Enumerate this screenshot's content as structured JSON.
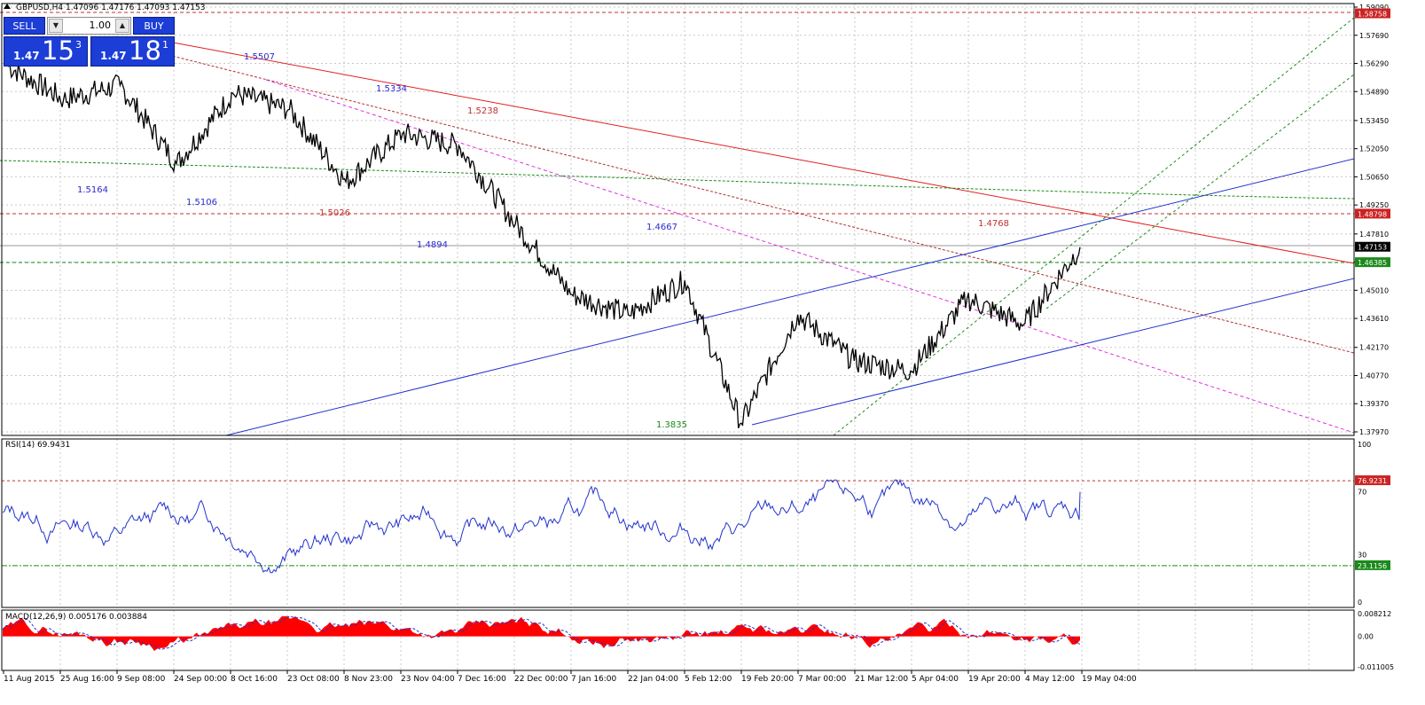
{
  "header": {
    "title": "GBPUSD,H4 1.47096 1.47176 1.47093 1.47153"
  },
  "trade_panel": {
    "sell_label": "SELL",
    "buy_label": "BUY",
    "lot": "1.00",
    "sell_prefix": "1.47",
    "sell_big": "15",
    "sell_sup": "3",
    "buy_prefix": "1.47",
    "buy_big": "18",
    "buy_sup": "1",
    "arrow_down": "▼",
    "arrow_up": "▲"
  },
  "price_axis": {
    "ticks": [
      "1.59090",
      "1.57690",
      "1.56290",
      "1.54890",
      "1.53450",
      "1.52050",
      "1.50650",
      "1.49250",
      "1.47810",
      "1.46410",
      "1.45010",
      "1.43610",
      "1.42170",
      "1.40770",
      "1.39370",
      "1.37970"
    ],
    "highlights": [
      {
        "label": "1.58758",
        "color": "#cc2222",
        "text_color": "#ffffff"
      },
      {
        "label": "1.48798",
        "color": "#cc2222",
        "text_color": "#ffffff"
      },
      {
        "label": "1.47153",
        "color": "#000000",
        "text_color": "#ffffff"
      },
      {
        "label": "1.46385",
        "color": "#1a8a1a",
        "text_color": "#ffffff"
      }
    ]
  },
  "annotations": [
    {
      "text": "1.5507",
      "color": "#2a2ad0"
    },
    {
      "text": "1.5334",
      "color": "#2a2ad0"
    },
    {
      "text": "1.5238",
      "color": "#c03030"
    },
    {
      "text": "1.5164",
      "color": "#2a2ad0"
    },
    {
      "text": "1.5106",
      "color": "#2a2ad0"
    },
    {
      "text": "1.5026",
      "color": "#c03030"
    },
    {
      "text": "1.4894",
      "color": "#2a2ad0"
    },
    {
      "text": "1.4667",
      "color": "#2a2ad0"
    },
    {
      "text": "1.4768",
      "color": "#c03030"
    },
    {
      "text": "1.3835",
      "color": "#1a8a1a"
    }
  ],
  "rsi": {
    "label": "RSI(14) 69.9431",
    "ticks": [
      "100",
      "70",
      "30",
      "0"
    ],
    "high_level": "76.9231",
    "low_level": "23.1156"
  },
  "macd": {
    "label": "MACD(12,26,9) 0.005176 0.003884",
    "ticks": [
      "0.008212",
      "0.00",
      "-0.011005"
    ]
  },
  "time_axis": [
    "11 Aug 2015",
    "25 Aug 16:00",
    "9 Sep 08:00",
    "24 Sep 00:00",
    "8 Oct 16:00",
    "23 Oct 08:00",
    "8 Nov 23:00",
    "23 Nov 04:00",
    "7 Dec 16:00",
    "22 Dec 00:00",
    "7 Jan 16:00",
    "22 Jan 04:00",
    "5 Feb 12:00",
    "19 Feb 20:00",
    "7 Mar 00:00",
    "21 Mar 12:00",
    "5 Apr 04:00",
    "19 Apr 20:00",
    "4 May 12:00",
    "19 May 04:00"
  ],
  "colors": {
    "candle": "#000000",
    "rsi_line": "#2233cc",
    "macd_fill": "#ff0000",
    "grid": "#c8c8c8"
  },
  "chart_data": {
    "type": "line",
    "title": "GBPUSD,H4",
    "x": [
      "11 Aug 2015",
      "25 Aug 16:00",
      "9 Sep 08:00",
      "24 Sep 00:00",
      "8 Oct 16:00",
      "23 Oct 08:00",
      "8 Nov 23:00",
      "23 Nov 04:00",
      "7 Dec 16:00",
      "22 Dec 00:00",
      "7 Jan 16:00",
      "22 Jan 04:00",
      "5 Feb 12:00",
      "19 Feb 20:00",
      "7 Mar 00:00",
      "21 Mar 12:00",
      "5 Apr 04:00",
      "19 Apr 20:00",
      "4 May 12:00",
      "19 May 04:00"
    ],
    "series": [
      {
        "values": [
          1.562,
          1.545,
          1.552,
          1.513,
          1.548,
          1.54,
          1.504,
          1.528,
          1.522,
          1.483,
          1.448,
          1.438,
          1.455,
          1.384,
          1.438,
          1.415,
          1.41,
          1.446,
          1.433,
          1.4715
        ]
      }
    ],
    "ylim": [
      1.3797,
      1.5909
    ],
    "xlabel": "",
    "ylabel": ""
  }
}
